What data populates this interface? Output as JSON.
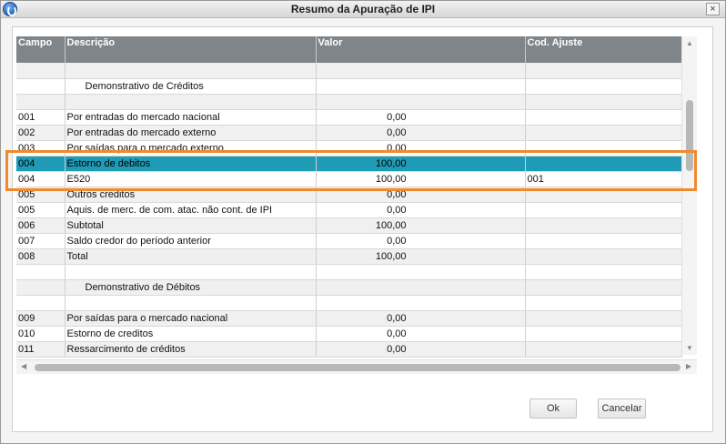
{
  "window": {
    "title": "Resumo da Apuração de IPI",
    "close_label": "×"
  },
  "grid": {
    "columns": [
      "Campo",
      "Descrição",
      "Valor",
      "Cod. Ajuste"
    ],
    "rows": [
      {
        "campo": "",
        "descricao": "",
        "valor": "",
        "cod": "",
        "type": "blank"
      },
      {
        "campo": "",
        "descricao": "Demonstrativo de Créditos",
        "valor": "",
        "cod": "",
        "type": "section"
      },
      {
        "campo": "",
        "descricao": "",
        "valor": "",
        "cod": "",
        "type": "blank"
      },
      {
        "campo": "001",
        "descricao": "Por entradas do mercado nacional",
        "valor": "0,00",
        "cod": ""
      },
      {
        "campo": "002",
        "descricao": "Por entradas do mercado externo",
        "valor": "0,00",
        "cod": ""
      },
      {
        "campo": "003",
        "descricao": "Por saídas para o mercado externo",
        "valor": "0,00",
        "cod": ""
      },
      {
        "campo": "004",
        "descricao": "Estorno de debitos",
        "valor": "100,00",
        "cod": "",
        "type": "selected"
      },
      {
        "campo": "004",
        "descricao": "E520",
        "valor": "100,00",
        "cod": "001"
      },
      {
        "campo": "005",
        "descricao": "Outros creditos",
        "valor": "0,00",
        "cod": ""
      },
      {
        "campo": "005",
        "descricao": "Aquis. de merc. de com. atac. não cont. de IPI",
        "valor": "0,00",
        "cod": ""
      },
      {
        "campo": "006",
        "descricao": "Subtotal",
        "valor": "100,00",
        "cod": ""
      },
      {
        "campo": "007",
        "descricao": "Saldo credor do período anterior",
        "valor": "0,00",
        "cod": ""
      },
      {
        "campo": "008",
        "descricao": "Total",
        "valor": "100,00",
        "cod": ""
      },
      {
        "campo": "",
        "descricao": "",
        "valor": "",
        "cod": "",
        "type": "blank"
      },
      {
        "campo": "",
        "descricao": "Demonstrativo de Débitos",
        "valor": "",
        "cod": "",
        "type": "section"
      },
      {
        "campo": "",
        "descricao": "",
        "valor": "",
        "cod": "",
        "type": "blank"
      },
      {
        "campo": "009",
        "descricao": "Por saídas para o mercado nacional",
        "valor": "0,00",
        "cod": ""
      },
      {
        "campo": "010",
        "descricao": "Estorno de creditos",
        "valor": "0,00",
        "cod": ""
      },
      {
        "campo": "011",
        "descricao": "Ressarcimento de créditos",
        "valor": "0,00",
        "cod": ""
      }
    ]
  },
  "buttons": {
    "ok": "Ok",
    "cancel": "Cancelar"
  },
  "colors": {
    "header": "#7f8589",
    "selected_row": "#1f9bb5",
    "highlight_border": "#f08a2e"
  }
}
